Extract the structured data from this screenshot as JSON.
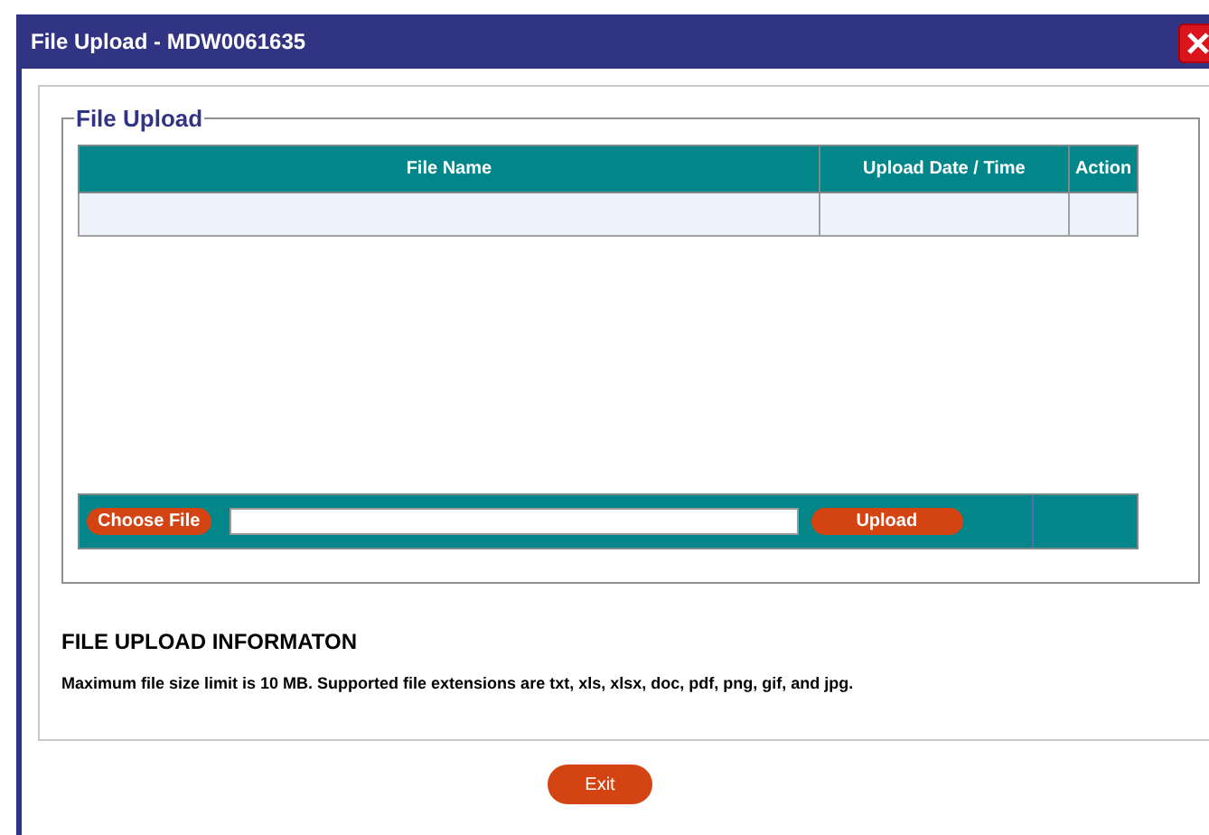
{
  "window": {
    "title": "File Upload - MDW0061635"
  },
  "fieldset": {
    "legend": "File Upload"
  },
  "table": {
    "columns": [
      "File Name",
      "Upload Date / Time",
      "Action"
    ]
  },
  "upload_bar": {
    "choose_button": "Choose File",
    "upload_button": "Upload"
  },
  "info": {
    "heading": "FILE UPLOAD INFORMATON",
    "text": "Maximum file size limit is 10 MB. Supported file extensions are txt, xls, xlsx, doc, pdf, png, gif, and jpg."
  },
  "buttons": {
    "exit": "Exit"
  }
}
